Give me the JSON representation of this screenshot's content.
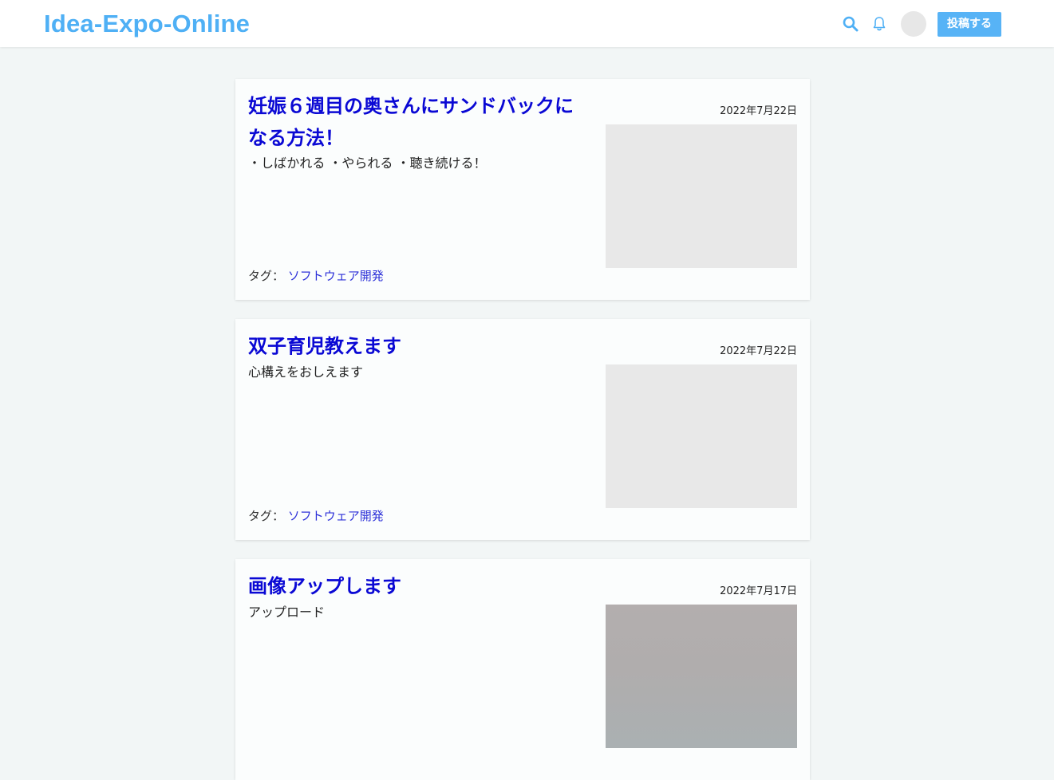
{
  "header": {
    "logo": "Idea-Expo-Online",
    "search_icon": "search-icon",
    "bell_icon": "bell-icon",
    "post_button": "投稿する",
    "colors": {
      "brand": "#4fb0f5",
      "button": "#57b3f6"
    }
  },
  "posts": [
    {
      "title": "妊娠６週目の奥さんにサンドバックになる方法！",
      "description": "・しばかれる ・やられる ・聴き続ける！",
      "date": "2022年7月22日",
      "tag_label": "タグ：",
      "tag": "ソフトウェア開発"
    },
    {
      "title": "双子育児教えます",
      "description": "心構えをおしえます",
      "date": "2022年7月22日",
      "tag_label": "タグ：",
      "tag": "ソフトウェア開発"
    },
    {
      "title": "画像アップします",
      "description": "アップロード",
      "date": "2022年7月17日"
    }
  ]
}
